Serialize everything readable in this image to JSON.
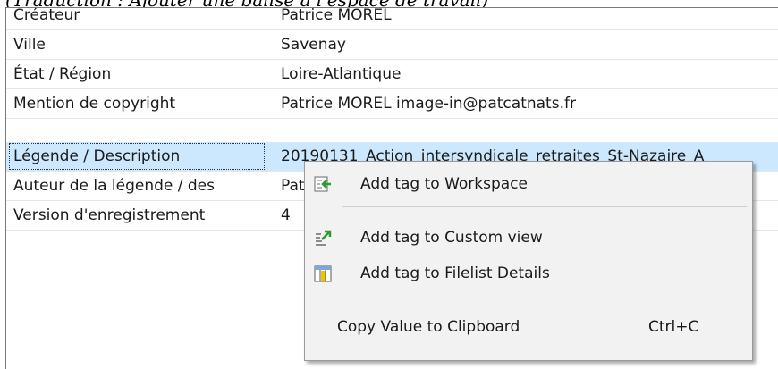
{
  "caption": "(Traduction : Ajouter une balise à l'espace de travail)",
  "rows": [
    {
      "name": "Créateur",
      "value": "Patrice MOREL"
    },
    {
      "name": "Ville",
      "value": "Savenay"
    },
    {
      "name": "État / Région",
      "value": "Loire-Atlantique"
    },
    {
      "name": "Mention de copyright",
      "value": "Patrice MOREL image-in@patcatnats.fr"
    },
    {
      "name": "Légende / Description",
      "value": "20190131_Action_intersyndicale_retraites_St-Nazaire_A"
    },
    {
      "name": "Auteur de la légende / des",
      "value": "Pat"
    },
    {
      "name": "Version d'enregistrement",
      "value": "4"
    }
  ],
  "context_menu": {
    "items": [
      {
        "label": "Add tag to Workspace",
        "icon": "add-to-workspace-icon"
      },
      {
        "label": "Add tag to Custom view",
        "icon": "custom-view-icon"
      },
      {
        "label": "Add tag to Filelist Details",
        "icon": "filelist-details-icon"
      },
      {
        "label": "Copy Value to Clipboard",
        "shortcut": "Ctrl+C"
      }
    ]
  }
}
